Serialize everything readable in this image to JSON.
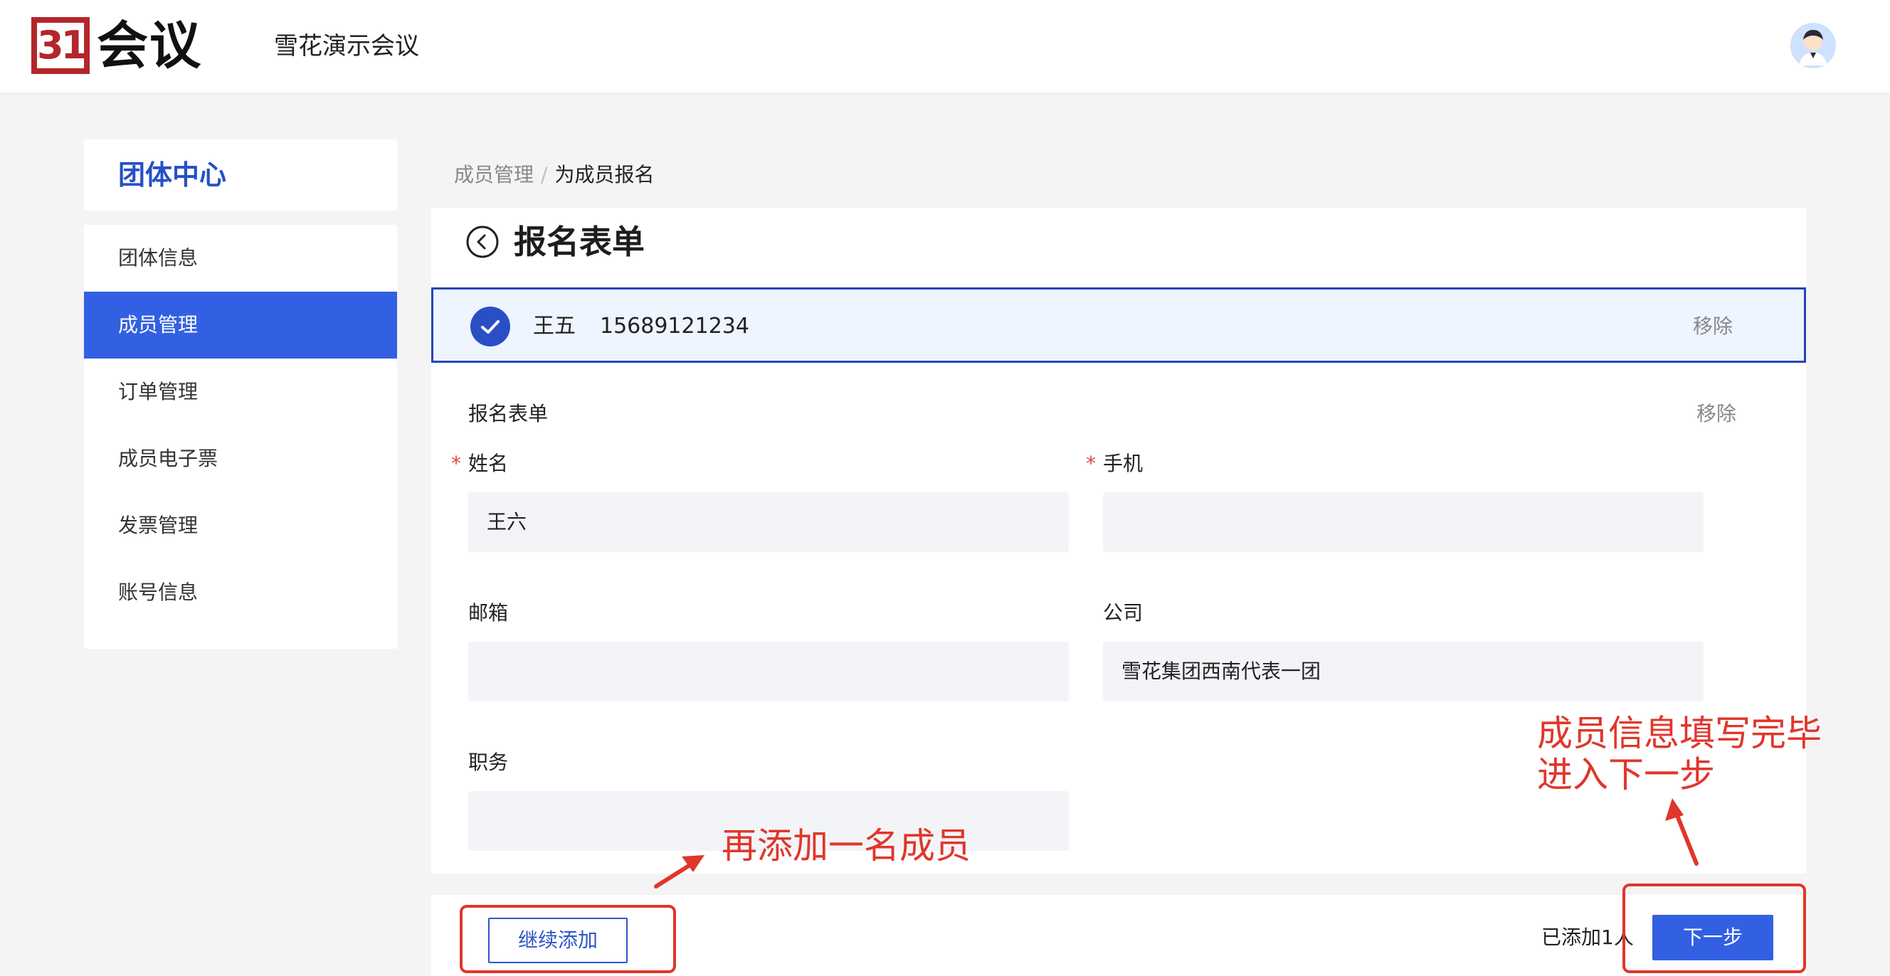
{
  "header": {
    "logo_mark": "31",
    "logo_text": "会议",
    "conference_title": "雪花演示会议"
  },
  "sidebar": {
    "title": "团体中心",
    "items": [
      {
        "label": "团体信息",
        "active": false
      },
      {
        "label": "成员管理",
        "active": true
      },
      {
        "label": "订单管理",
        "active": false
      },
      {
        "label": "成员电子票",
        "active": false
      },
      {
        "label": "发票管理",
        "active": false
      },
      {
        "label": "账号信息",
        "active": false
      }
    ]
  },
  "breadcrumb": {
    "parent": "成员管理",
    "separator": "/",
    "current": "为成员报名"
  },
  "form": {
    "title": "报名表单",
    "member": {
      "name": "王五",
      "phone": "15689121234",
      "remove_label": "移除"
    },
    "section_label": "报名表单",
    "section_remove_label": "移除",
    "required_mark": "*",
    "fields": {
      "name": {
        "label": "姓名",
        "value": "王六",
        "placeholder": "",
        "required": true
      },
      "phone": {
        "label": "手机",
        "value": "",
        "placeholder": "",
        "required": true
      },
      "email": {
        "label": "邮箱",
        "value": "",
        "placeholder": "",
        "required": false
      },
      "company": {
        "label": "公司",
        "value": "雪花集团西南代表一团",
        "placeholder": "",
        "required": false
      },
      "position": {
        "label": "职务",
        "value": "",
        "placeholder": "",
        "required": false
      }
    }
  },
  "footer": {
    "continue_label": "继续添加",
    "added_count_text": "已添加1人",
    "next_label": "下一步"
  },
  "annotations": {
    "add_more_text": "再添加一名成员",
    "next_step_line1": "成员信息填写完毕",
    "next_step_line2": "进入下一步"
  },
  "colors": {
    "primary": "#3360e2",
    "brand_red": "#b3262a",
    "annotation_red": "#e0362b",
    "selected_row_bg": "#eef5ff",
    "selected_row_border": "#2646b8"
  },
  "icons": {
    "back": "back-circle-icon",
    "check": "check-circle-icon",
    "avatar": "user-avatar-icon"
  }
}
